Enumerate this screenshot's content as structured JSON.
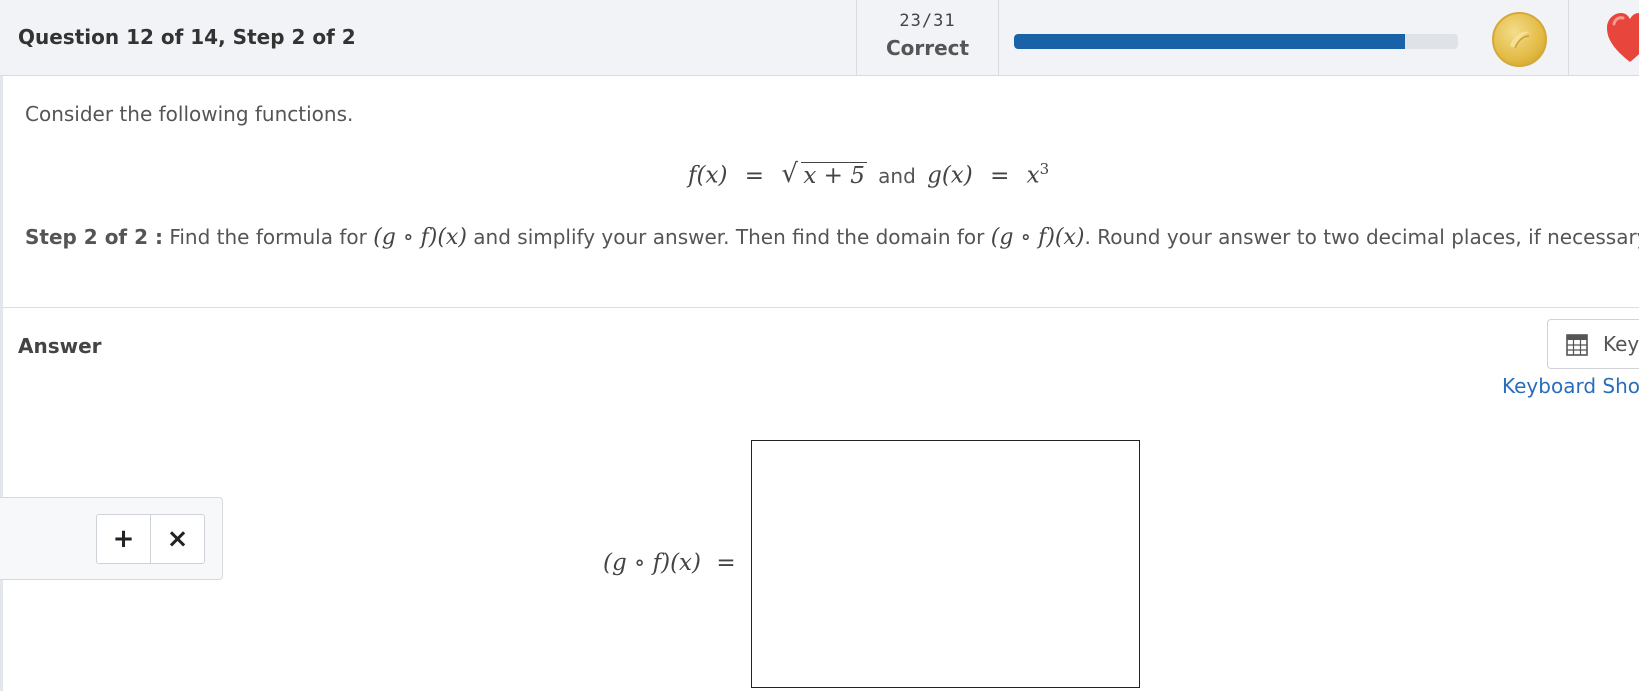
{
  "header": {
    "question_title": "Question 12 of 14, Step 2 of 2",
    "score": "23/31",
    "score_status": "Correct",
    "progress_fraction": 0.88,
    "progress_color": "#1a62a8",
    "coin_icon": "coin-icon",
    "heart_icon": "heart-icon"
  },
  "question": {
    "intro": "Consider the following functions.",
    "formula": {
      "f_lhs": "f(x)",
      "eq1": "=",
      "radicand": "x + 5",
      "and": "and",
      "g_lhs": "g(x)",
      "eq2": "=",
      "g_base": "x",
      "g_exp": "3"
    },
    "step_label": "Step 2 of 2 :",
    "step_text_1": "Find the formula for",
    "composition": "(g ∘ f)(x)",
    "step_text_2": "and simplify your answer. Then find the domain for",
    "step_text_3": ". Round your answer to two decimal places, if necessary."
  },
  "answer": {
    "label": "Answer",
    "keypad_label": "Key",
    "keyboard_shortcuts": "Keyboard Sho",
    "plus": "+",
    "times": "×",
    "lhs": "(g ∘ f)(x)",
    "eq": "=",
    "input_value": ""
  }
}
